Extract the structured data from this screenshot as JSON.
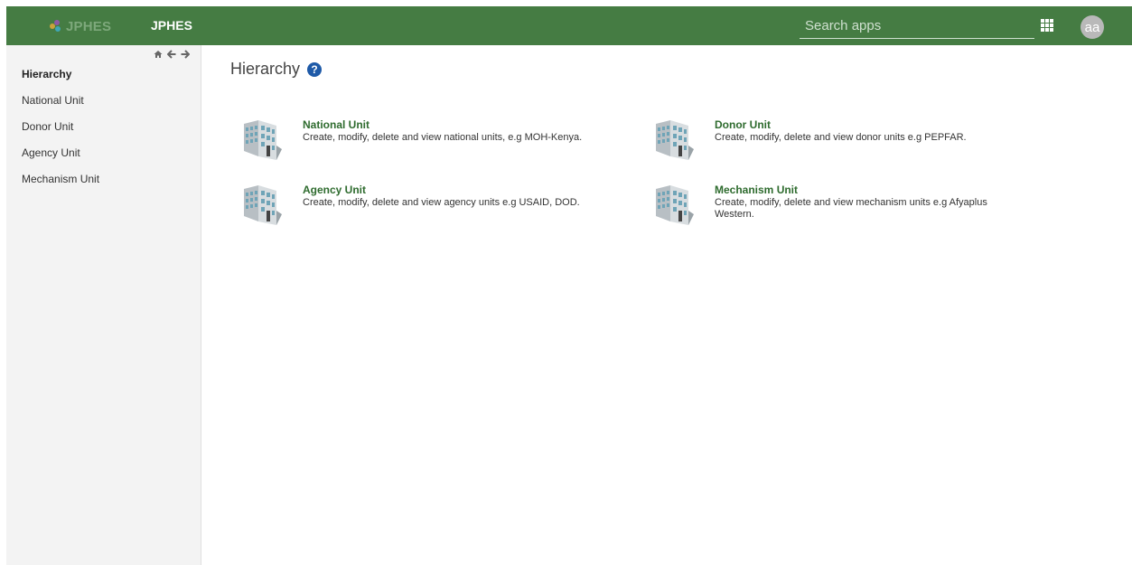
{
  "header": {
    "logo_text": "JPHES",
    "app_title": "JPHES",
    "search_placeholder": "Search apps",
    "apps_icon": "grid-icon",
    "avatar_initials": "aa",
    "bg_color": "#457c43"
  },
  "sidebar": {
    "nav_icons": [
      "home-icon",
      "arrow-left-icon",
      "arrow-right-icon"
    ],
    "items": [
      {
        "label": "Hierarchy",
        "active": true
      },
      {
        "label": "National Unit",
        "active": false
      },
      {
        "label": "Donor Unit",
        "active": false
      },
      {
        "label": "Agency Unit",
        "active": false
      },
      {
        "label": "Mechanism Unit",
        "active": false
      }
    ]
  },
  "main": {
    "title": "Hierarchy",
    "help_icon": "question-icon",
    "cards": [
      {
        "title": "National Unit",
        "description": "Create, modify, delete and view national units, e.g MOH-Kenya.",
        "icon": "building-icon"
      },
      {
        "title": "Donor Unit",
        "description": "Create, modify, delete and view donor units e.g PEPFAR.",
        "icon": "building-icon"
      },
      {
        "title": "Agency Unit",
        "description": "Create, modify, delete and view agency units e.g USAID, DOD.",
        "icon": "building-icon"
      },
      {
        "title": "Mechanism Unit",
        "description": "Create, modify, delete and view mechanism units e.g Afyaplus Western.",
        "icon": "building-icon"
      }
    ]
  }
}
